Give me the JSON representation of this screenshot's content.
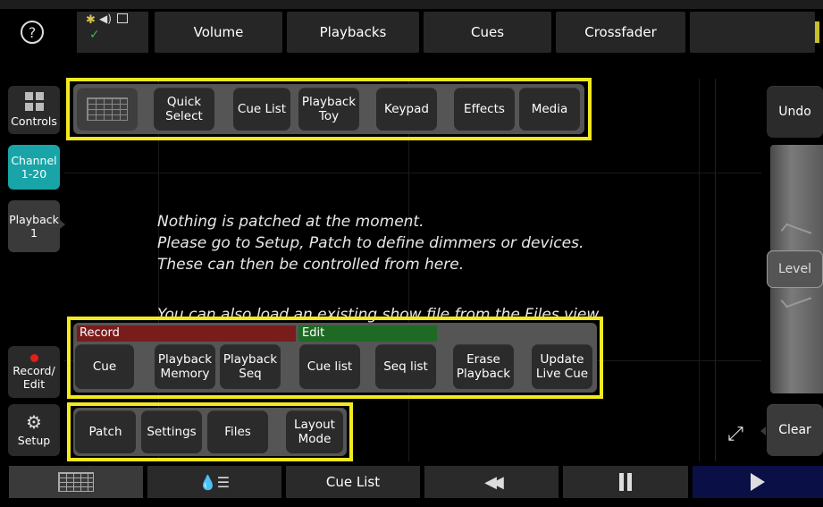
{
  "top_bar": {
    "help_icon": "help-circle-icon",
    "status_icons": [
      "brightness-icon",
      "speaker-icon",
      "image-icon",
      "check-icon"
    ],
    "tabs": [
      {
        "label": "Volume"
      },
      {
        "label": "Playbacks"
      },
      {
        "label": "Cues"
      },
      {
        "label": "Crossfader"
      }
    ]
  },
  "sidebar": {
    "controls_label": "Controls",
    "channel_label": "Channel\n1-20",
    "playback_label": "Playback\n1",
    "record_label": "Record/\nEdit",
    "setup_label": "Setup"
  },
  "controls_menu": {
    "items": [
      {
        "label": "Quick\nSelect"
      },
      {
        "label": "Cue List"
      },
      {
        "label": "Playback\nToy"
      },
      {
        "label": "Keypad"
      },
      {
        "label": "Effects"
      },
      {
        "label": "Media"
      }
    ]
  },
  "message": {
    "line1": "Nothing is patched at the moment.",
    "line2": "Please go to Setup, Patch to define dimmers or devices.",
    "line3": "These can then be controlled from here.",
    "line4": "You can also load an existing show file from the Files view."
  },
  "record_menu": {
    "record_header": "Record",
    "edit_header": "Edit",
    "items": [
      {
        "label": "Cue"
      },
      {
        "label": "Playback\nMemory"
      },
      {
        "label": "Playback\nSeq"
      },
      {
        "label": "Cue list"
      },
      {
        "label": "Seq list"
      },
      {
        "label": "Erase\nPlayback"
      },
      {
        "label": "Update\nLive Cue"
      }
    ],
    "colors": {
      "record": "#7a1c1c",
      "edit": "#1e6a24"
    }
  },
  "setup_menu": {
    "items": [
      {
        "label": "Patch"
      },
      {
        "label": "Settings"
      },
      {
        "label": "Files"
      },
      {
        "label": "Layout\nMode"
      }
    ]
  },
  "right_panel": {
    "undo_label": "Undo",
    "level_label": "Level",
    "clear_label": "Clear"
  },
  "bottom_bar": {
    "cue_list_label": "Cue List",
    "icons": [
      "grid-icon",
      "color-picker-icon",
      "rewind-icon",
      "pause-icon",
      "play-icon"
    ]
  },
  "colors": {
    "highlight": "#f3e91e",
    "accent": "#1aa6a6",
    "play_bg": "#0a0f45"
  }
}
